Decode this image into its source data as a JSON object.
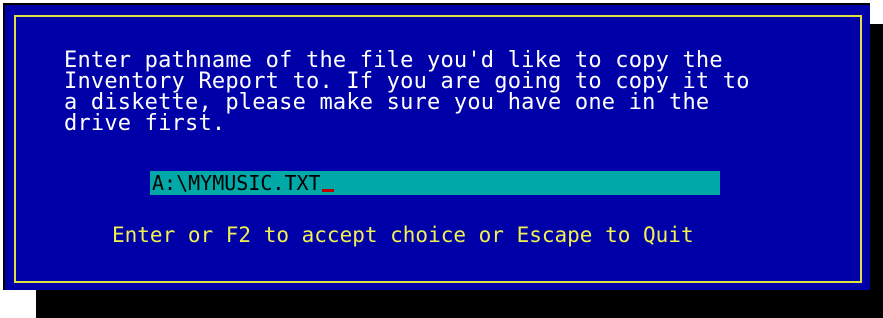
{
  "dialog": {
    "message": "Enter pathname of the file you'd like to copy the\nInventory Report to. If you are going to copy it to\na diskette, please make sure you have one in the\ndrive first.",
    "path_value": "A:\\MYMUSIC.TXT",
    "hint": "Enter or F2 to accept choice or Escape to Quit"
  },
  "colors": {
    "dialog_background": "#0000a8",
    "frame_border": "#e0e040",
    "message_text": "#ffffff",
    "input_background": "#00a8a8",
    "input_text": "#000000",
    "cursor": "#c00000",
    "hint_text": "#f0f050"
  }
}
